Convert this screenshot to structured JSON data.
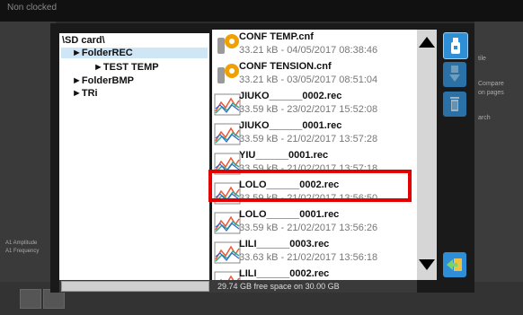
{
  "background": {
    "top_label": "Non clocked",
    "side_labels": [
      "A1 Amplitude",
      "A1 Frequency"
    ],
    "right_labels": [
      "tile",
      "Compare",
      "on pages",
      "arch"
    ]
  },
  "tree": {
    "items": [
      {
        "label": "\\SD card\\"
      },
      {
        "label": "►FolderREC"
      },
      {
        "label": "►TEST TEMP"
      },
      {
        "label": "►FolderBMP"
      },
      {
        "label": "►TRi"
      }
    ],
    "selected_index": 1
  },
  "files": [
    {
      "name": "CONF TEMP.cnf",
      "meta": "33.21 kB - 04/05/2017 08:38:46",
      "type": "config"
    },
    {
      "name": "CONF TENSION.cnf",
      "meta": "33.21 kB - 03/05/2017 08:51:04",
      "type": "config"
    },
    {
      "name": "JIUKO______0002.rec",
      "meta": "33.59 kB - 23/02/2017 15:52:08",
      "type": "record"
    },
    {
      "name": "JIUKO______0001.rec",
      "meta": "33.59 kB - 21/02/2017 13:57:28",
      "type": "record"
    },
    {
      "name": "YIU______0001.rec",
      "meta": "33.59 kB - 21/02/2017 13:57:18",
      "type": "record"
    },
    {
      "name": "LOLO______0002.rec",
      "meta": "33.59 kB - 21/02/2017 13:56:50",
      "type": "record"
    },
    {
      "name": "LOLO______0001.rec",
      "meta": "33.59 kB - 21/02/2017 13:56:26",
      "type": "record"
    },
    {
      "name": "LILI______0003.rec",
      "meta": "33.63 kB - 21/02/2017 13:56:18",
      "type": "record"
    },
    {
      "name": "LILI______0002.rec",
      "meta": "",
      "type": "record"
    }
  ],
  "highlighted_file_index": 5,
  "status": {
    "free_space": "29.74 GB free space on 30.00 GB",
    "progress_fraction": 0.0
  },
  "buttons": {
    "usb_icon": "usb-stick-icon",
    "transfer_icon": "transfer-icon",
    "delete_icon": "trash-icon",
    "open_icon": "folder-open-icon"
  },
  "colors": {
    "highlight": "#e30000",
    "selection": "#cfe6f6",
    "button_blue": "#2f8fd6"
  }
}
